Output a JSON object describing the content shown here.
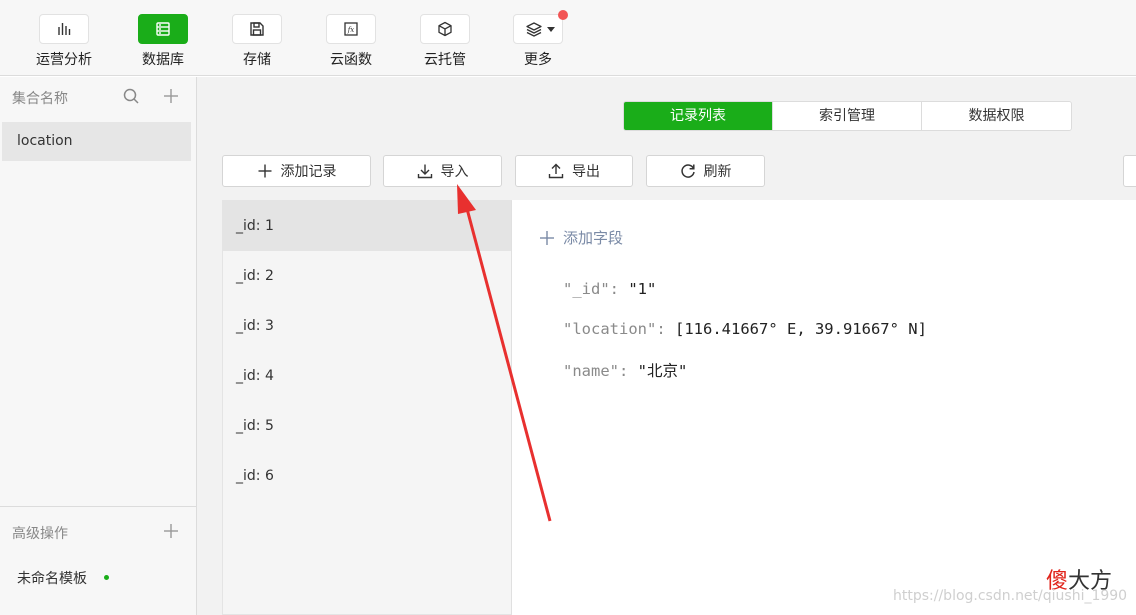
{
  "toolbar": {
    "items": [
      {
        "label": "运营分析",
        "icon": "bar-chart-icon"
      },
      {
        "label": "数据库",
        "icon": "database-icon",
        "active": true
      },
      {
        "label": "存储",
        "icon": "save-icon"
      },
      {
        "label": "云函数",
        "icon": "function-icon"
      },
      {
        "label": "云托管",
        "icon": "cube-icon"
      },
      {
        "label": "更多",
        "icon": "layers-icon",
        "has_notification": true
      }
    ]
  },
  "sidebar": {
    "heading": "集合名称",
    "collections": [
      "location"
    ],
    "advanced_heading": "高级操作",
    "template_label": "未命名模板"
  },
  "tabs": [
    "记录列表",
    "索引管理",
    "数据权限"
  ],
  "actions": {
    "add": "添加记录",
    "import": "导入",
    "export": "导出",
    "refresh": "刷新"
  },
  "records": [
    "_id: 1",
    "_id: 2",
    "_id: 3",
    "_id: 4",
    "_id: 5",
    "_id: 6"
  ],
  "detail": {
    "add_field": "添加字段",
    "fields": [
      {
        "key": "\"_id\"",
        "sep": ": ",
        "value": "\"1\""
      },
      {
        "key": "\"location\"",
        "sep": ": ",
        "value": "[116.41667° E, 39.91667° N]"
      },
      {
        "key": "\"name\"",
        "sep": ": ",
        "value": "\"北京\""
      }
    ]
  },
  "watermark": {
    "logo_red": "傻",
    "logo_rest": "大方",
    "url": "https://blog.csdn.net/qiushi_1990"
  },
  "colors": {
    "accent": "#1aad19",
    "arrow": "#e8302f",
    "notification": "#f25454"
  }
}
